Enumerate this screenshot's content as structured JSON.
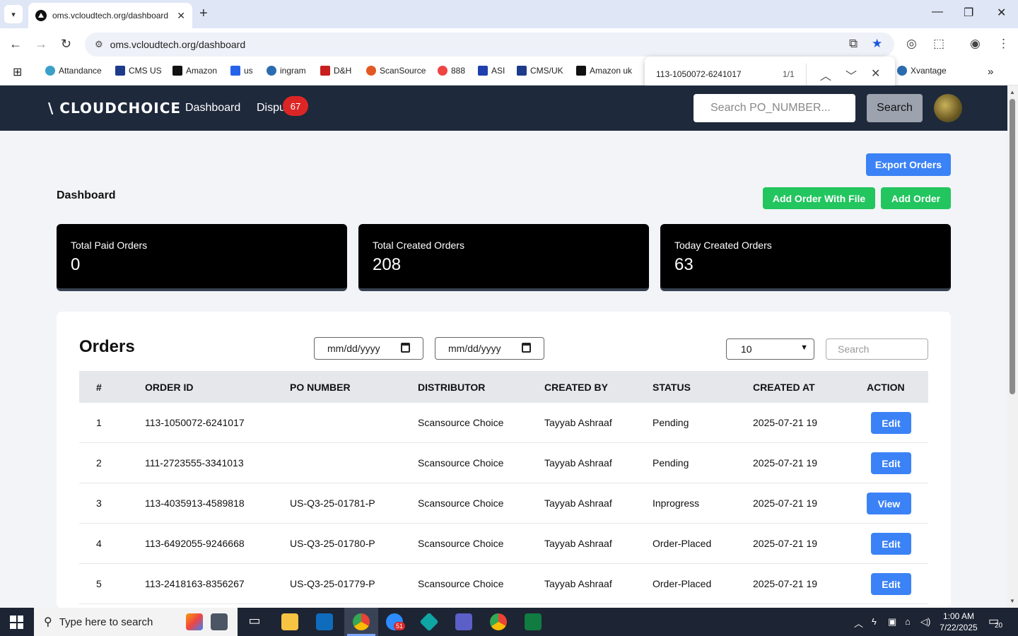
{
  "browser": {
    "tab_title": "oms.vcloudtech.org/dashboard",
    "url": "oms.vcloudtech.org/dashboard",
    "bookmarks": [
      "Attandance",
      "CMS US",
      "Amazon",
      "us",
      "ingram",
      "D&H",
      "ScanSource",
      "888",
      "ASI",
      "CMS/UK",
      "Amazon uk",
      "Xvantage"
    ],
    "find": {
      "query": "113-1050072-6241017",
      "count": "1/1"
    }
  },
  "nav": {
    "logo": "CLOUDCHOICE",
    "dashboard": "Dashboard",
    "dispute": "Dispu",
    "dispute_badge": "67",
    "search_placeholder": "Search PO_NUMBER...",
    "search_button": "Search"
  },
  "page": {
    "title": "Dashboard",
    "export_button": "Export Orders",
    "add_with_file_button": "Add Order With File",
    "add_button": "Add Order"
  },
  "stats": [
    {
      "label": "Total Paid Orders",
      "value": "0"
    },
    {
      "label": "Total Created Orders",
      "value": "208"
    },
    {
      "label": "Today Created Orders",
      "value": "63"
    }
  ],
  "orders": {
    "title": "Orders",
    "date_from": "mm/dd/yyyy",
    "date_to": "mm/dd/yyyy",
    "page_size": "10",
    "search_placeholder": "Search",
    "columns": [
      "#",
      "ORDER ID",
      "PO NUMBER",
      "DISTRIBUTOR",
      "CREATED BY",
      "STATUS",
      "CREATED AT",
      "ACTION"
    ],
    "rows": [
      {
        "num": "1",
        "order_id": "113-1050072-6241017",
        "po": "",
        "distributor": "Scansource Choice",
        "created_by": "Tayyab Ashraaf",
        "status": "Pending",
        "created_at": "2025-07-21 19",
        "action": "Edit"
      },
      {
        "num": "2",
        "order_id": "111-2723555-3341013",
        "po": "",
        "distributor": "Scansource Choice",
        "created_by": "Tayyab Ashraaf",
        "status": "Pending",
        "created_at": "2025-07-21 19",
        "action": "Edit"
      },
      {
        "num": "3",
        "order_id": "113-4035913-4589818",
        "po": "US-Q3-25-01781-P",
        "distributor": "Scansource Choice",
        "created_by": "Tayyab Ashraaf",
        "status": "Inprogress",
        "created_at": "2025-07-21 19",
        "action": "View"
      },
      {
        "num": "4",
        "order_id": "113-6492055-9246668",
        "po": "US-Q3-25-01780-P",
        "distributor": "Scansource Choice",
        "created_by": "Tayyab Ashraaf",
        "status": "Order-Placed",
        "created_at": "2025-07-21 19",
        "action": "Edit"
      },
      {
        "num": "5",
        "order_id": "113-2418163-8356267",
        "po": "US-Q3-25-01779-P",
        "distributor": "Scansource Choice",
        "created_by": "Tayyab Ashraaf",
        "status": "Order-Placed",
        "created_at": "2025-07-21 19",
        "action": "Edit"
      }
    ]
  },
  "taskbar": {
    "search_placeholder": "Type here to search",
    "time": "1:00 AM",
    "date": "7/22/2025",
    "notifications": "20",
    "zoom_badge": "51"
  },
  "colors": {
    "navbar": "#1e293b",
    "blue": "#3b82f6",
    "green": "#22c55e",
    "badge": "#dc2626"
  }
}
